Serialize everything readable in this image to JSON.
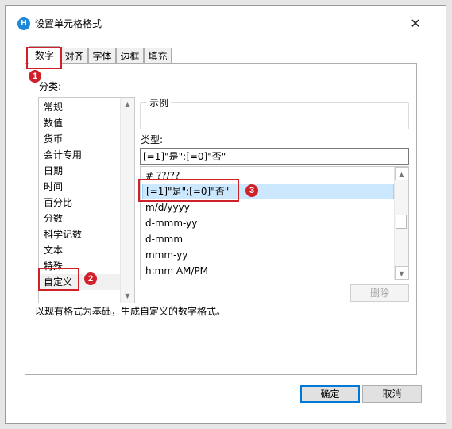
{
  "dialog": {
    "title": "设置单元格格式",
    "app_icon_text": "H",
    "close_glyph": "✕"
  },
  "tabs": [
    {
      "label": "数字",
      "active": true
    },
    {
      "label": "对齐",
      "active": false
    },
    {
      "label": "字体",
      "active": false
    },
    {
      "label": "边框",
      "active": false
    },
    {
      "label": "填充",
      "active": false
    }
  ],
  "category": {
    "label": "分类:",
    "items": [
      "常规",
      "数值",
      "货币",
      "会计专用",
      "日期",
      "时间",
      "百分比",
      "分数",
      "科学记数",
      "文本",
      "特殊",
      "自定义"
    ],
    "selected": "自定义"
  },
  "sample": {
    "label": "示例",
    "value": ""
  },
  "type": {
    "label": "类型:",
    "input_value": "[=1]\"是\";[=0]\"否\"",
    "list": [
      "# ??/??",
      "[=1]\"是\";[=0]\"否\"",
      "m/d/yyyy",
      "d-mmm-yy",
      "d-mmm",
      "mmm-yy",
      "h:mm AM/PM"
    ],
    "selected": "[=1]\"是\";[=0]\"否\""
  },
  "delete_button": "删除",
  "description": "以现有格式为基础，生成自定义的数字格式。",
  "ok_button": "确定",
  "cancel_button": "取消",
  "annotations": {
    "badge1": "1",
    "badge2": "2",
    "badge3": "3",
    "color": "#d0202a"
  },
  "scroll_arrows": {
    "up": "▲",
    "down": "▼"
  }
}
